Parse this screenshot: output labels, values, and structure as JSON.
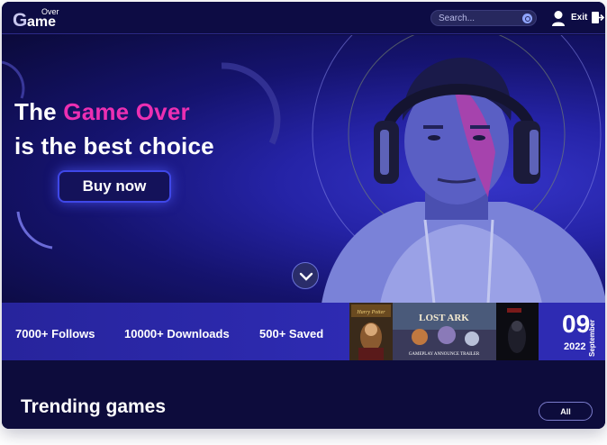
{
  "header": {
    "logo_initial": "G",
    "logo_over": "Over",
    "logo_rest": "ame",
    "search_placeholder": "Search...",
    "exit_label": "Exit"
  },
  "hero": {
    "title_prefix": "The",
    "title_accent": "Game Over",
    "title_line2": "is the best choice",
    "buy_label": "Buy now"
  },
  "stats": {
    "follows": "7000+ Follows",
    "downloads": "10000+ Downloads",
    "saved": "500+ Saved"
  },
  "thumbnails": [
    {
      "title": "Harry Potter",
      "icon": "harry-potter-cover"
    },
    {
      "title": "LOST ARK",
      "subtitle": "GAMEPLAY ANNOUNCE TRAILER",
      "icon": "lost-ark-cover"
    },
    {
      "title": "",
      "icon": "dark-game-cover"
    }
  ],
  "date": {
    "day": "09",
    "year": "2022",
    "month": "September"
  },
  "trending": {
    "title": "Trending games",
    "all_label": "All"
  },
  "colors": {
    "accent": "#ec2fb2",
    "primary": "#2e2bb3",
    "background": "#0b0a3a"
  }
}
